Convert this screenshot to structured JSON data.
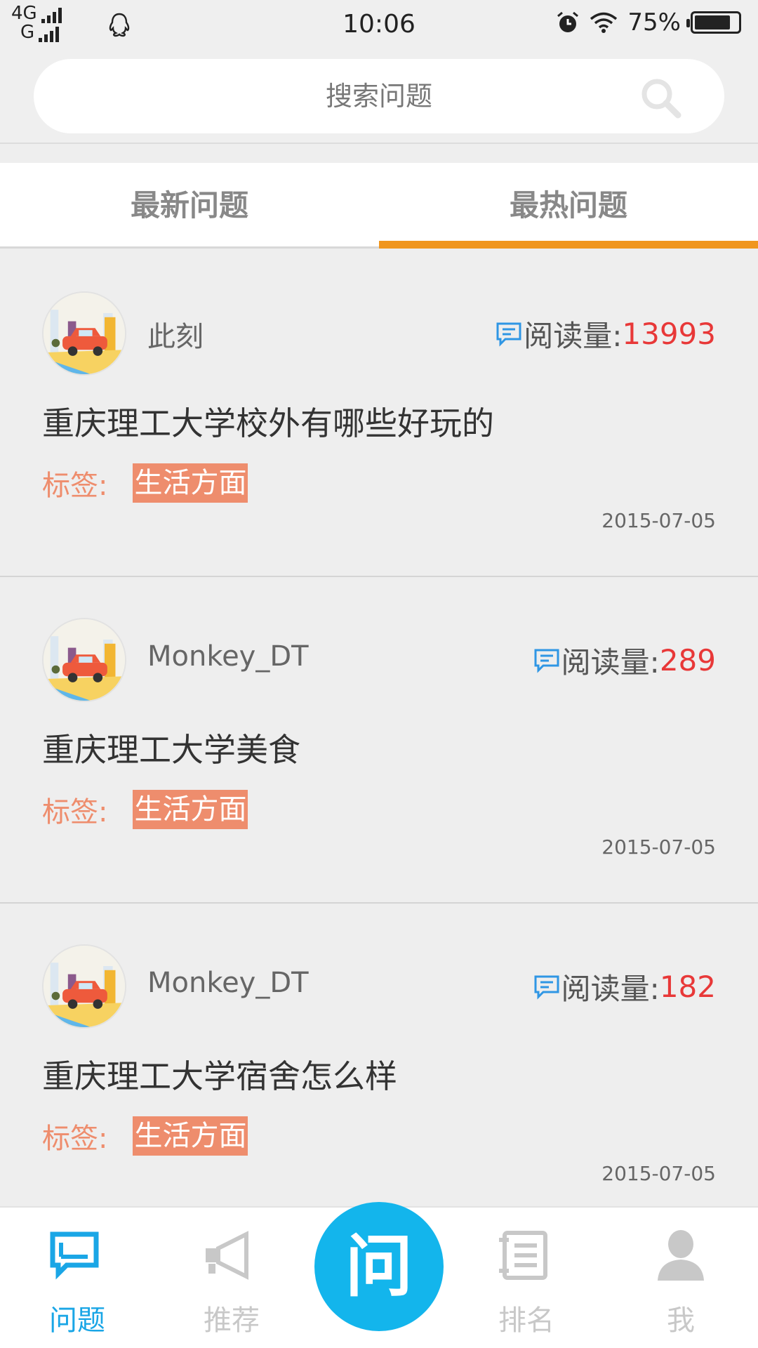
{
  "status_bar": {
    "network_top": "4G",
    "network_bottom": "G",
    "time": "10:06",
    "battery": "75%"
  },
  "search": {
    "placeholder": "搜索问题"
  },
  "tabs": [
    {
      "label": "最新问题",
      "active": false
    },
    {
      "label": "最热问题",
      "active": true
    }
  ],
  "reads_label": "阅读量:",
  "tag_label": "标签:",
  "posts": [
    {
      "author": "此刻",
      "read_count": "13993",
      "title": "重庆理工大学校外有哪些好玩的",
      "tag": "生活方面",
      "date": "2015-07-05"
    },
    {
      "author": "Monkey_DT",
      "read_count": "289",
      "title": "重庆理工大学美食",
      "tag": "生活方面",
      "date": "2015-07-05"
    },
    {
      "author": "Monkey_DT",
      "read_count": "182",
      "title": "重庆理工大学宿舍怎么样",
      "tag": "生活方面",
      "date": "2015-07-05"
    }
  ],
  "bottom_nav": {
    "items": [
      {
        "label": "问题",
        "icon": "question-chat-icon",
        "active": true
      },
      {
        "label": "推荐",
        "icon": "megaphone-icon",
        "active": false
      },
      {
        "label": "排名",
        "icon": "ranking-list-icon",
        "active": false
      },
      {
        "label": "我",
        "icon": "user-icon",
        "active": false
      }
    ],
    "ask_label": "问"
  },
  "colors": {
    "accent_orange": "#f0961e",
    "tag_salmon": "#ee8d6d",
    "count_red": "#e83838",
    "primary_blue": "#13b5ec"
  }
}
